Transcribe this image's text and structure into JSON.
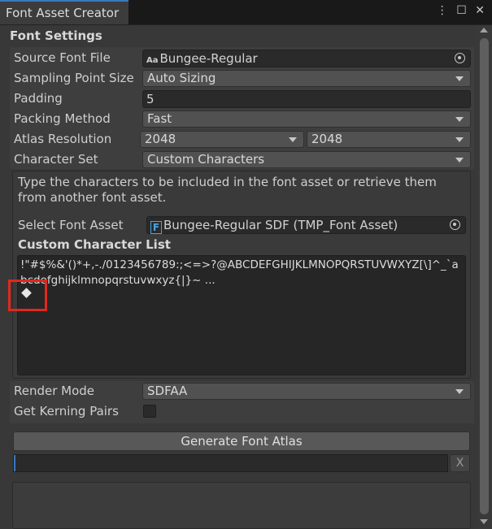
{
  "window": {
    "tab_title": "Font Asset Creator",
    "menu_icon": "kebab-menu-icon",
    "maximize_icon": "maximize-icon",
    "close_icon": "close-icon"
  },
  "font_settings": {
    "section_title": "Font Settings",
    "source_font_file": {
      "label": "Source Font File",
      "value": "Bungee-Regular",
      "icon": "font-file-icon"
    },
    "sampling_point_size": {
      "label": "Sampling Point Size",
      "value": "Auto Sizing"
    },
    "padding": {
      "label": "Padding",
      "value": "5"
    },
    "packing_method": {
      "label": "Packing Method",
      "value": "Fast"
    },
    "atlas_resolution": {
      "label": "Atlas Resolution",
      "width": "2048",
      "height": "2048"
    },
    "character_set": {
      "label": "Character Set",
      "value": "Custom Characters"
    }
  },
  "custom_box": {
    "help_text": "Type the characters to be included in the font asset or retrieve them from another font asset.",
    "select_font_asset": {
      "label": "Select Font Asset",
      "value": "Bungee-Regular SDF (TMP_Font Asset)",
      "icon": "tmp-font-asset-icon"
    },
    "custom_character_list": {
      "label": "Custom Character List",
      "value": "!\"#$%&'()*+,-./0123456789:;<=>?@ABCDEFGHIJKLMNOPQRSTUVWXYZ[\\]^_`abcdefghijklmnopqrstuvwxyz{|}~ ..."
    }
  },
  "render_mode": {
    "label": "Render Mode",
    "value": "SDFAA"
  },
  "get_kerning_pairs": {
    "label": "Get Kerning Pairs",
    "checked": false
  },
  "generate_button": {
    "label": "Generate Font Atlas"
  },
  "progress": {
    "value": 0,
    "cancel_label": "X"
  },
  "colors": {
    "accent": "#3a79bb",
    "highlight": "#e0281e",
    "background": "#383838"
  }
}
